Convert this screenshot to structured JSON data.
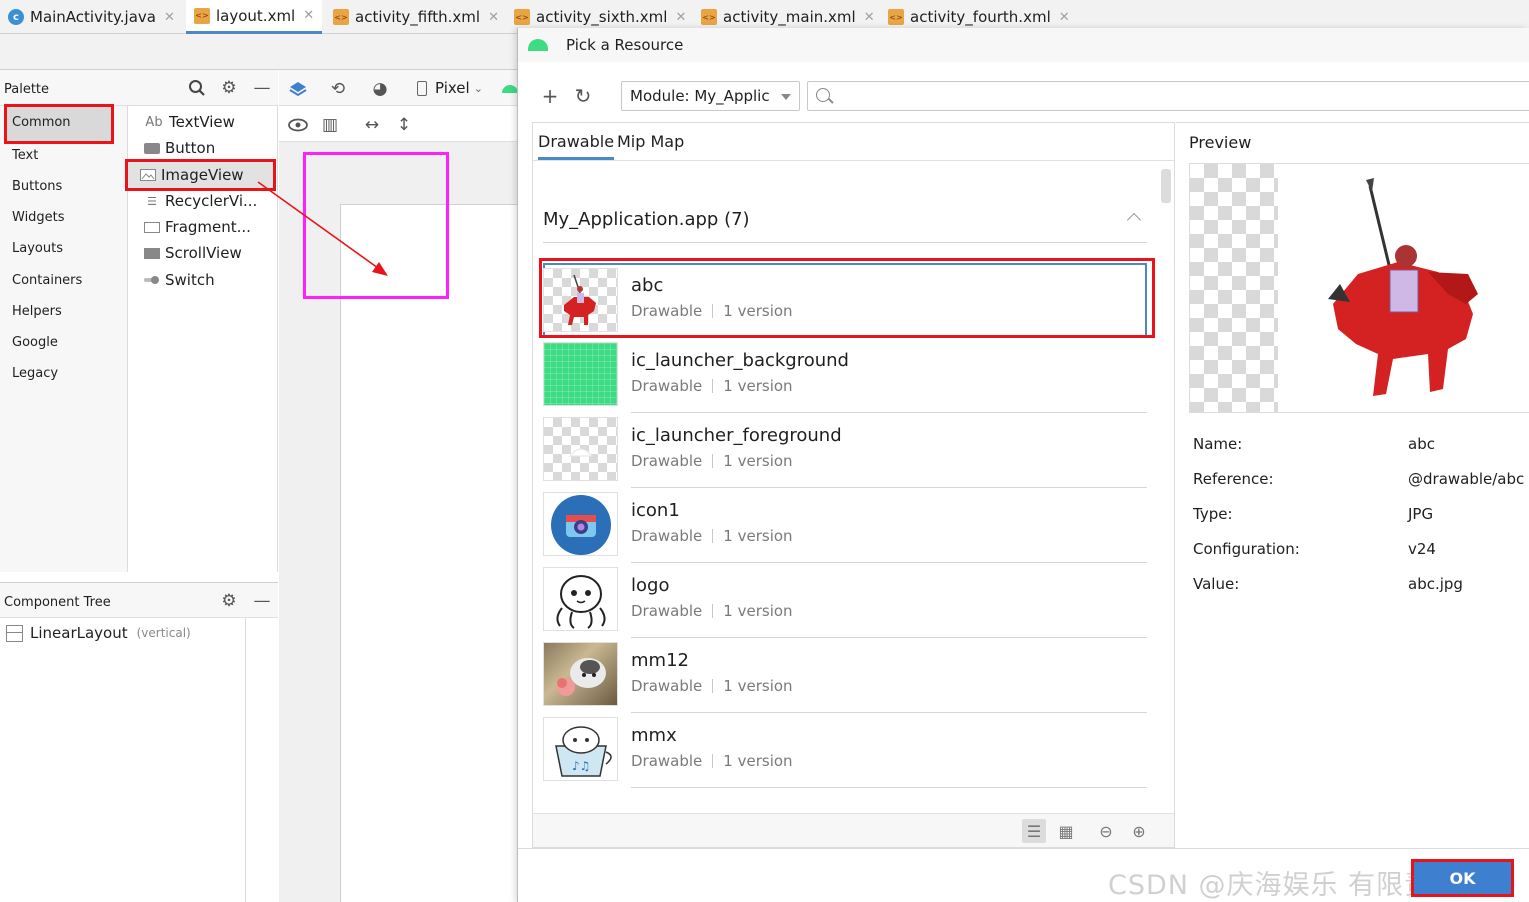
{
  "tabs": [
    {
      "label": "MainActivity.java",
      "icon": "java-class-icon"
    },
    {
      "label": "layout.xml",
      "icon": "xml-file-icon"
    },
    {
      "label": "activity_fifth.xml",
      "icon": "xml-file-icon"
    },
    {
      "label": "activity_sixth.xml",
      "icon": "xml-file-icon"
    },
    {
      "label": "activity_main.xml",
      "icon": "xml-file-icon"
    },
    {
      "label": "activity_fourth.xml",
      "icon": "xml-file-icon"
    }
  ],
  "palette": {
    "title": "Palette",
    "categories": [
      "Common",
      "Text",
      "Buttons",
      "Widgets",
      "Layouts",
      "Containers",
      "Helpers",
      "Google",
      "Legacy"
    ],
    "selected_category": "Common",
    "widgets": [
      {
        "label": "TextView",
        "icon": "textview-icon"
      },
      {
        "label": "Button",
        "icon": "button-icon"
      },
      {
        "label": "ImageView",
        "icon": "imageview-icon"
      },
      {
        "label": "RecyclerVi...",
        "icon": "recyclerview-icon"
      },
      {
        "label": "Fragment...",
        "icon": "fragment-icon"
      },
      {
        "label": "ScrollView",
        "icon": "scrollview-icon"
      },
      {
        "label": "Switch",
        "icon": "switch-icon"
      }
    ],
    "selected_widget": "ImageView",
    "textview_prefix": "Ab"
  },
  "design_toolbar": {
    "device": "Pixel"
  },
  "component_tree": {
    "title": "Component Tree",
    "root": "LinearLayout",
    "root_sub": "(vertical)"
  },
  "dialog": {
    "title": "Pick a Resource",
    "module": "Module: My_Applic",
    "search_placeholder": "",
    "tabs": [
      "Drawable",
      "Mip Map"
    ],
    "active_tab": "Drawable",
    "group": "My_Application.app (7)",
    "resources": [
      {
        "name": "abc",
        "type": "Drawable",
        "versions": "1 version",
        "selected": true
      },
      {
        "name": "ic_launcher_background",
        "type": "Drawable",
        "versions": "1 version"
      },
      {
        "name": "ic_launcher_foreground",
        "type": "Drawable",
        "versions": "1 version"
      },
      {
        "name": "icon1",
        "type": "Drawable",
        "versions": "1 version"
      },
      {
        "name": "logo",
        "type": "Drawable",
        "versions": "1 version"
      },
      {
        "name": "mm12",
        "type": "Drawable",
        "versions": "1 version"
      },
      {
        "name": "mmx",
        "type": "Drawable",
        "versions": "1 version"
      }
    ],
    "preview": {
      "title": "Preview",
      "props": [
        {
          "label": "Name:",
          "value": "abc"
        },
        {
          "label": "Reference:",
          "value": "@drawable/abc"
        },
        {
          "label": "Type:",
          "value": "JPG"
        },
        {
          "label": "Configuration:",
          "value": "v24"
        },
        {
          "label": "Value:",
          "value": "abc.jpg"
        }
      ]
    },
    "ok_label": "OK"
  },
  "watermark": "CSDN @庆海娱乐 有限责任公司",
  "colors": {
    "accent": "#4a88c7",
    "highlight_red": "#e8141a",
    "magenta": "#ff20ff",
    "ok_blue": "#3f7fcf"
  }
}
